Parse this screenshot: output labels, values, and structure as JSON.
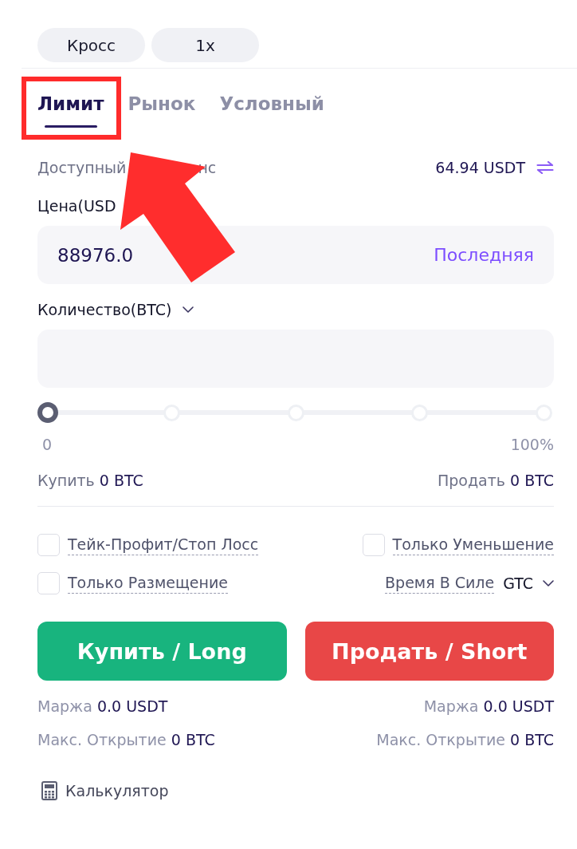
{
  "mode_buttons": [
    {
      "label": "Кросс"
    },
    {
      "label": "1x"
    }
  ],
  "order_tabs": [
    {
      "label": "Лимит",
      "selected": true
    },
    {
      "label": "Рынок",
      "selected": false
    },
    {
      "label": "Условный",
      "selected": false
    }
  ],
  "available_balance": {
    "label": "Доступный",
    "label_end": "нс",
    "value": "64.94 USDT"
  },
  "price": {
    "label": "Цена(USD",
    "value": "88976.0",
    "action": "Последняя"
  },
  "quantity": {
    "label": "Количество(BTC)"
  },
  "slider": {
    "level": 0,
    "min_label": "0",
    "max_label": "100%"
  },
  "amounts": [
    {
      "label": "Купить",
      "value": "0 BTC"
    },
    {
      "label": "Продать",
      "value": "0 BTC"
    }
  ],
  "options": [
    {
      "kind": "checkbox",
      "label": "Тейк-Профит/Стоп Лосс",
      "checked": false
    },
    {
      "kind": "checkbox",
      "label": "Только Уменьшение",
      "checked": false
    },
    {
      "kind": "checkbox",
      "label": "Только Размещение",
      "checked": false
    },
    {
      "kind": "select",
      "label": "Время В Силе",
      "value": "GTC"
    }
  ],
  "actions": [
    {
      "kind": "buy",
      "label": "Купить / Long",
      "details": [
        {
          "label": "Маржа",
          "value": "0.0 USDT"
        },
        {
          "label": "Макс. Открытие",
          "value": "0 BTC"
        }
      ]
    },
    {
      "kind": "sell",
      "label": "Продать / Short",
      "details": [
        {
          "label": "Маржа",
          "value": "0.0 USDT"
        },
        {
          "label": "Макс. Открытие",
          "value": "0 BTC"
        }
      ]
    }
  ],
  "calculator": {
    "label": "Калькулятор"
  },
  "annotations": {
    "highlight_box": true,
    "arrow": true
  }
}
